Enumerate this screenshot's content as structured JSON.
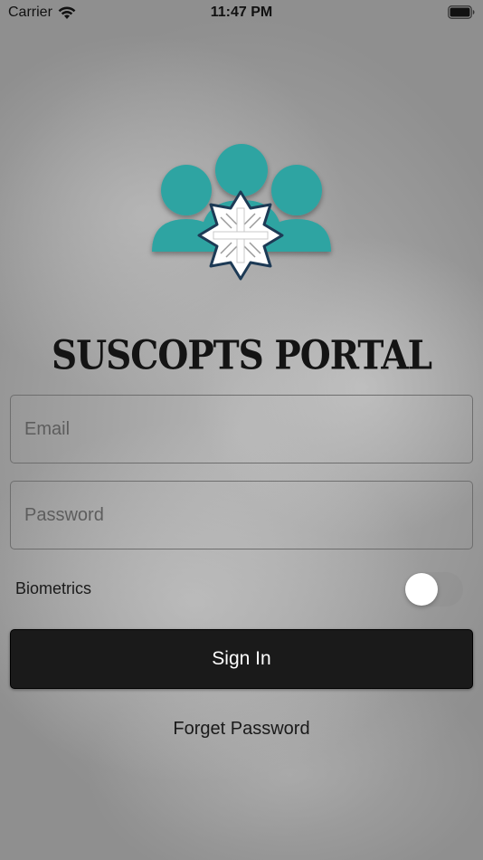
{
  "status_bar": {
    "carrier": "Carrier",
    "time": "11:47 PM"
  },
  "app": {
    "title": "SUSCOPTS PORTAL"
  },
  "colors": {
    "logo_teal": "#2ea4a2",
    "button_bg": "#1a1a1a"
  },
  "form": {
    "email": {
      "value": "",
      "placeholder": "Email"
    },
    "password": {
      "value": "",
      "placeholder": "Password"
    },
    "biometrics": {
      "label": "Biometrics",
      "enabled": false
    },
    "sign_in_label": "Sign In",
    "forget_password_label": "Forget Password"
  },
  "icons": [
    "wifi-icon",
    "battery-icon",
    "app-logo-icon"
  ]
}
